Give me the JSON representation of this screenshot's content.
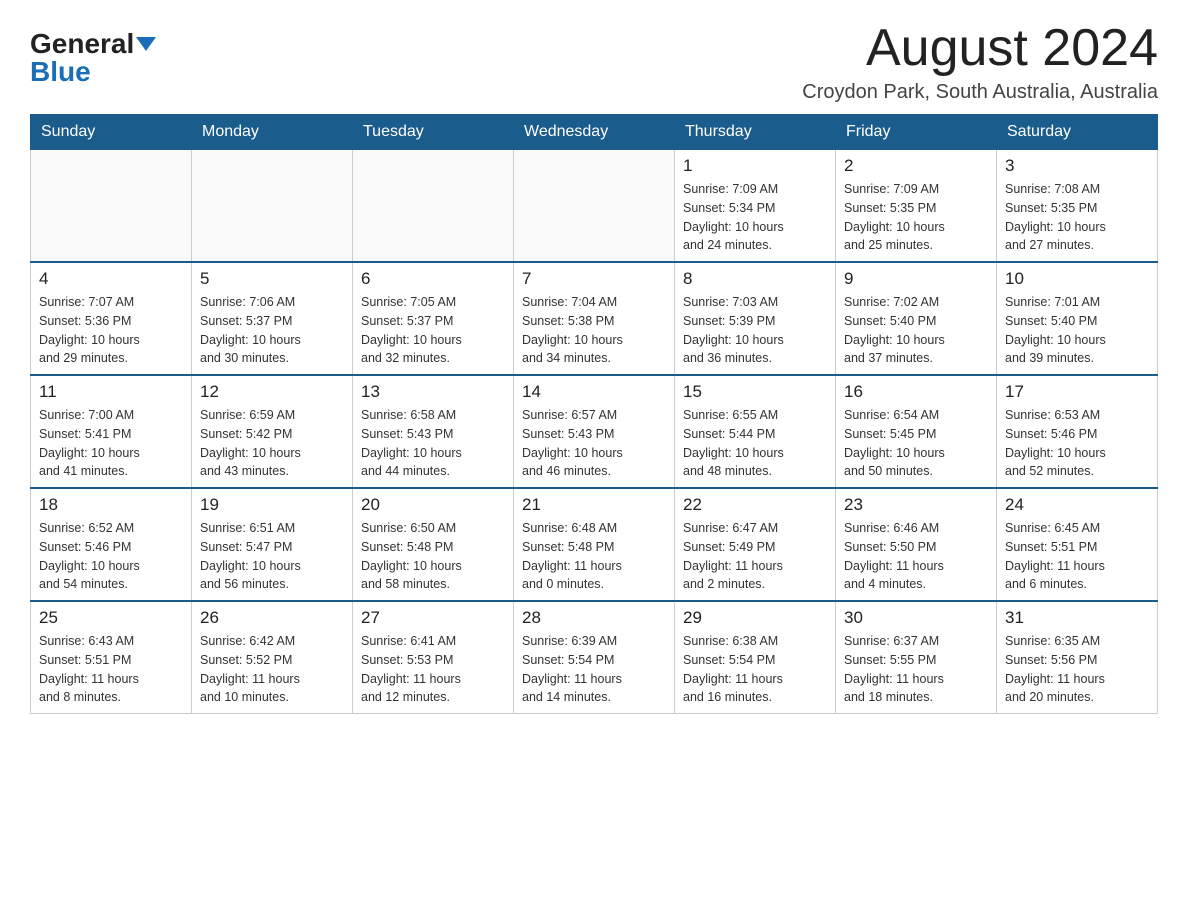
{
  "logo": {
    "general": "General",
    "blue": "Blue"
  },
  "header": {
    "month_year": "August 2024",
    "location": "Croydon Park, South Australia, Australia"
  },
  "days_of_week": [
    "Sunday",
    "Monday",
    "Tuesday",
    "Wednesday",
    "Thursday",
    "Friday",
    "Saturday"
  ],
  "weeks": [
    [
      {
        "day": "",
        "info": ""
      },
      {
        "day": "",
        "info": ""
      },
      {
        "day": "",
        "info": ""
      },
      {
        "day": "",
        "info": ""
      },
      {
        "day": "1",
        "info": "Sunrise: 7:09 AM\nSunset: 5:34 PM\nDaylight: 10 hours\nand 24 minutes."
      },
      {
        "day": "2",
        "info": "Sunrise: 7:09 AM\nSunset: 5:35 PM\nDaylight: 10 hours\nand 25 minutes."
      },
      {
        "day": "3",
        "info": "Sunrise: 7:08 AM\nSunset: 5:35 PM\nDaylight: 10 hours\nand 27 minutes."
      }
    ],
    [
      {
        "day": "4",
        "info": "Sunrise: 7:07 AM\nSunset: 5:36 PM\nDaylight: 10 hours\nand 29 minutes."
      },
      {
        "day": "5",
        "info": "Sunrise: 7:06 AM\nSunset: 5:37 PM\nDaylight: 10 hours\nand 30 minutes."
      },
      {
        "day": "6",
        "info": "Sunrise: 7:05 AM\nSunset: 5:37 PM\nDaylight: 10 hours\nand 32 minutes."
      },
      {
        "day": "7",
        "info": "Sunrise: 7:04 AM\nSunset: 5:38 PM\nDaylight: 10 hours\nand 34 minutes."
      },
      {
        "day": "8",
        "info": "Sunrise: 7:03 AM\nSunset: 5:39 PM\nDaylight: 10 hours\nand 36 minutes."
      },
      {
        "day": "9",
        "info": "Sunrise: 7:02 AM\nSunset: 5:40 PM\nDaylight: 10 hours\nand 37 minutes."
      },
      {
        "day": "10",
        "info": "Sunrise: 7:01 AM\nSunset: 5:40 PM\nDaylight: 10 hours\nand 39 minutes."
      }
    ],
    [
      {
        "day": "11",
        "info": "Sunrise: 7:00 AM\nSunset: 5:41 PM\nDaylight: 10 hours\nand 41 minutes."
      },
      {
        "day": "12",
        "info": "Sunrise: 6:59 AM\nSunset: 5:42 PM\nDaylight: 10 hours\nand 43 minutes."
      },
      {
        "day": "13",
        "info": "Sunrise: 6:58 AM\nSunset: 5:43 PM\nDaylight: 10 hours\nand 44 minutes."
      },
      {
        "day": "14",
        "info": "Sunrise: 6:57 AM\nSunset: 5:43 PM\nDaylight: 10 hours\nand 46 minutes."
      },
      {
        "day": "15",
        "info": "Sunrise: 6:55 AM\nSunset: 5:44 PM\nDaylight: 10 hours\nand 48 minutes."
      },
      {
        "day": "16",
        "info": "Sunrise: 6:54 AM\nSunset: 5:45 PM\nDaylight: 10 hours\nand 50 minutes."
      },
      {
        "day": "17",
        "info": "Sunrise: 6:53 AM\nSunset: 5:46 PM\nDaylight: 10 hours\nand 52 minutes."
      }
    ],
    [
      {
        "day": "18",
        "info": "Sunrise: 6:52 AM\nSunset: 5:46 PM\nDaylight: 10 hours\nand 54 minutes."
      },
      {
        "day": "19",
        "info": "Sunrise: 6:51 AM\nSunset: 5:47 PM\nDaylight: 10 hours\nand 56 minutes."
      },
      {
        "day": "20",
        "info": "Sunrise: 6:50 AM\nSunset: 5:48 PM\nDaylight: 10 hours\nand 58 minutes."
      },
      {
        "day": "21",
        "info": "Sunrise: 6:48 AM\nSunset: 5:48 PM\nDaylight: 11 hours\nand 0 minutes."
      },
      {
        "day": "22",
        "info": "Sunrise: 6:47 AM\nSunset: 5:49 PM\nDaylight: 11 hours\nand 2 minutes."
      },
      {
        "day": "23",
        "info": "Sunrise: 6:46 AM\nSunset: 5:50 PM\nDaylight: 11 hours\nand 4 minutes."
      },
      {
        "day": "24",
        "info": "Sunrise: 6:45 AM\nSunset: 5:51 PM\nDaylight: 11 hours\nand 6 minutes."
      }
    ],
    [
      {
        "day": "25",
        "info": "Sunrise: 6:43 AM\nSunset: 5:51 PM\nDaylight: 11 hours\nand 8 minutes."
      },
      {
        "day": "26",
        "info": "Sunrise: 6:42 AM\nSunset: 5:52 PM\nDaylight: 11 hours\nand 10 minutes."
      },
      {
        "day": "27",
        "info": "Sunrise: 6:41 AM\nSunset: 5:53 PM\nDaylight: 11 hours\nand 12 minutes."
      },
      {
        "day": "28",
        "info": "Sunrise: 6:39 AM\nSunset: 5:54 PM\nDaylight: 11 hours\nand 14 minutes."
      },
      {
        "day": "29",
        "info": "Sunrise: 6:38 AM\nSunset: 5:54 PM\nDaylight: 11 hours\nand 16 minutes."
      },
      {
        "day": "30",
        "info": "Sunrise: 6:37 AM\nSunset: 5:55 PM\nDaylight: 11 hours\nand 18 minutes."
      },
      {
        "day": "31",
        "info": "Sunrise: 6:35 AM\nSunset: 5:56 PM\nDaylight: 11 hours\nand 20 minutes."
      }
    ]
  ]
}
